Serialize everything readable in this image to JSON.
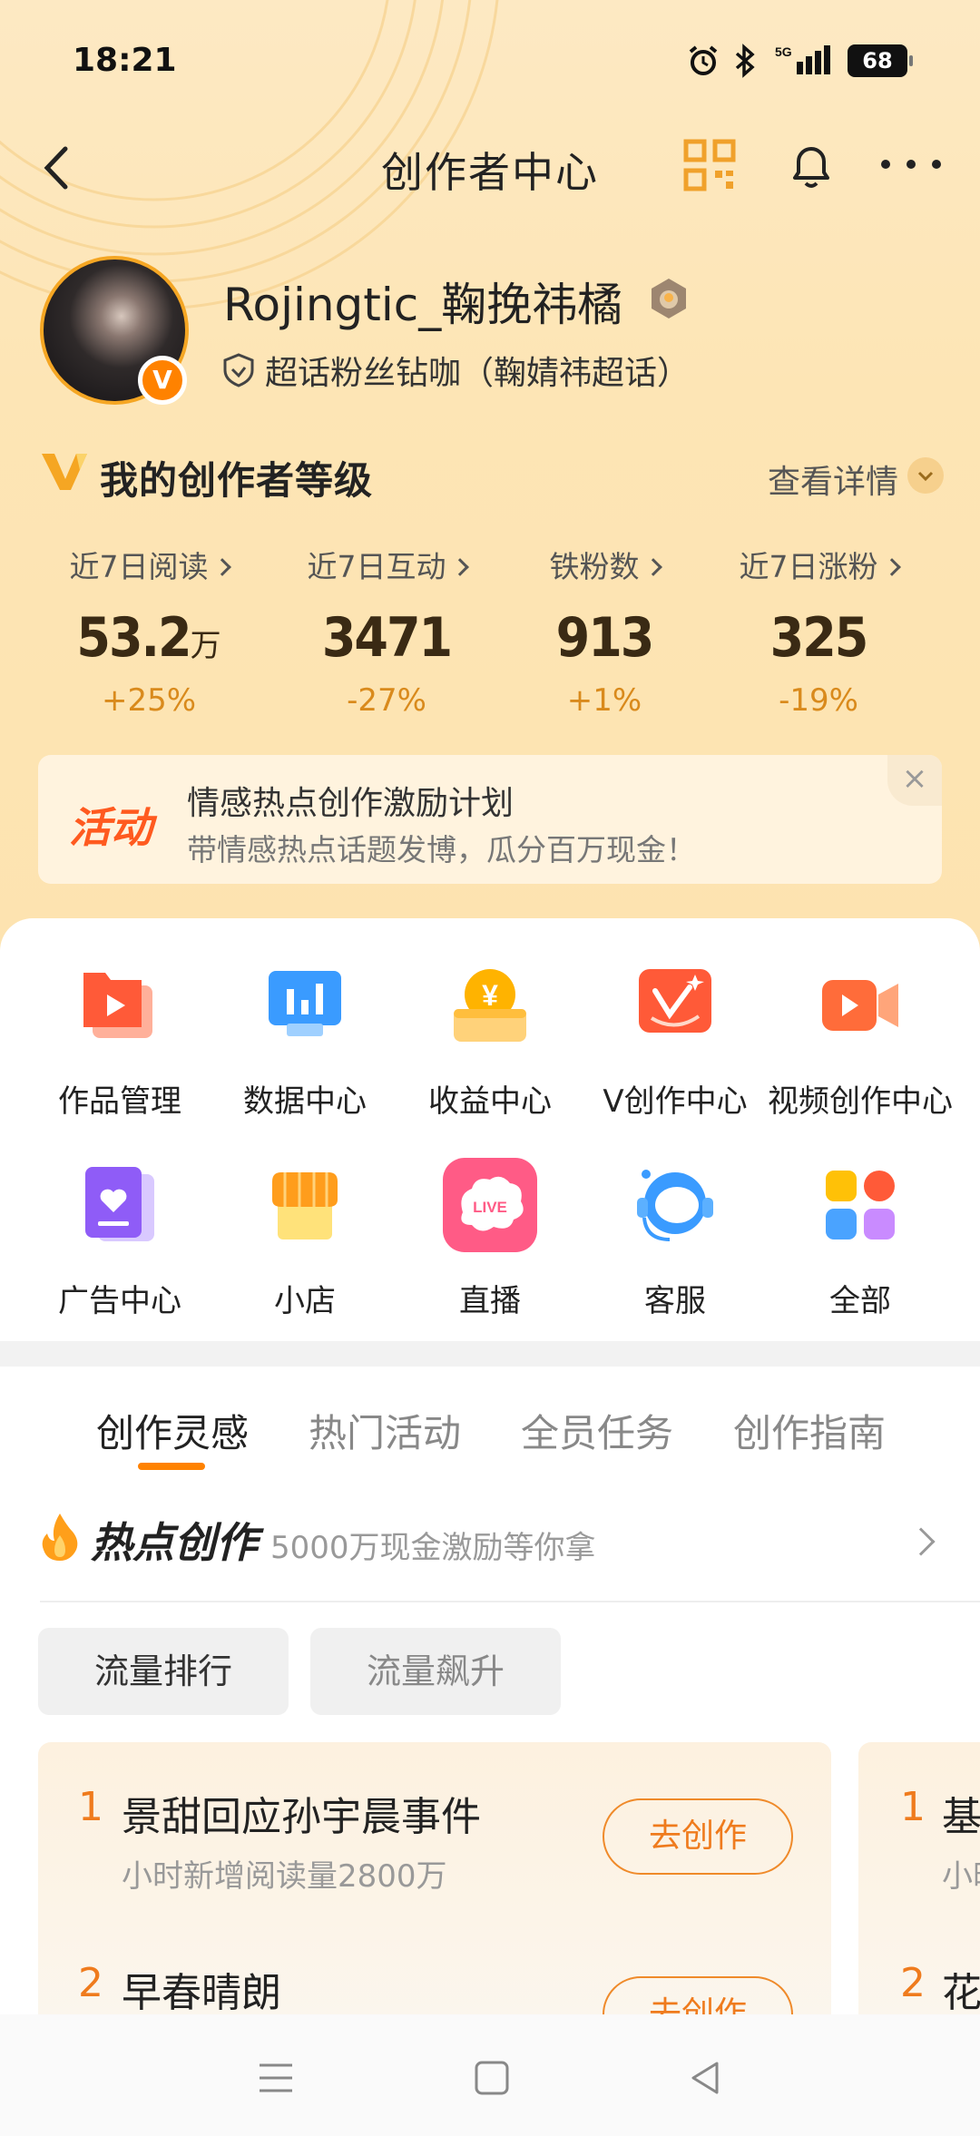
{
  "status_bar": {
    "time": "18:21",
    "battery": "68",
    "network": "5G"
  },
  "nav": {
    "title": "创作者中心"
  },
  "profile": {
    "username": "Rojingtic_鞠挽祎橘",
    "badge_letter": "V",
    "fan_label": "超话粉丝钻咖（鞠婧祎超话）"
  },
  "level": {
    "title": "我的创作者等级",
    "detail_label": "查看详情"
  },
  "stats": [
    {
      "label": "近7日阅读",
      "value": "53.2",
      "unit": "万",
      "change": "+25%"
    },
    {
      "label": "近7日互动",
      "value": "3471",
      "unit": "",
      "change": "-27%"
    },
    {
      "label": "铁粉数",
      "value": "913",
      "unit": "",
      "change": "+1%"
    },
    {
      "label": "近7日涨粉",
      "value": "325",
      "unit": "",
      "change": "-19%"
    }
  ],
  "activity": {
    "tag": "活动",
    "title": "情感热点创作激励计划",
    "subtitle": "带情感热点话题发博，瓜分百万现金！",
    "close": "×"
  },
  "tools": [
    {
      "label": "作品管理",
      "icon": "works-management-icon"
    },
    {
      "label": "数据中心",
      "icon": "data-center-icon"
    },
    {
      "label": "收益中心",
      "icon": "revenue-center-icon"
    },
    {
      "label": "V创作中心",
      "icon": "v-creation-center-icon"
    },
    {
      "label": "视频创作中心",
      "icon": "video-creation-icon"
    },
    {
      "label": "广告中心",
      "icon": "ad-center-icon"
    },
    {
      "label": "小店",
      "icon": "shop-icon"
    },
    {
      "label": "直播",
      "icon": "live-icon",
      "icon_text": "LIVE"
    },
    {
      "label": "客服",
      "icon": "customer-service-icon"
    },
    {
      "label": "全部",
      "icon": "all-apps-icon"
    }
  ],
  "tabs": [
    {
      "label": "创作灵感",
      "active": true
    },
    {
      "label": "热门活动",
      "active": false
    },
    {
      "label": "全员任务",
      "active": false
    },
    {
      "label": "创作指南",
      "active": false
    }
  ],
  "hot": {
    "title": "热点创作",
    "subtitle": "5000万现金激励等你拿"
  },
  "chips": [
    {
      "label": "流量排行",
      "active": true
    },
    {
      "label": "流量飙升",
      "active": false
    }
  ],
  "cards": [
    {
      "items": [
        {
          "rank": "1",
          "title": "景甜回应孙宇晨事件",
          "meta": "小时新增阅读量2800万",
          "button": "去创作"
        },
        {
          "rank": "2",
          "title": "早春晴朗",
          "meta": "",
          "button": "去创作"
        }
      ]
    },
    {
      "items": [
        {
          "rank": "1",
          "title": "基",
          "meta": "小时",
          "button": ""
        },
        {
          "rank": "2",
          "title": "花",
          "meta": "",
          "button": ""
        }
      ]
    }
  ]
}
